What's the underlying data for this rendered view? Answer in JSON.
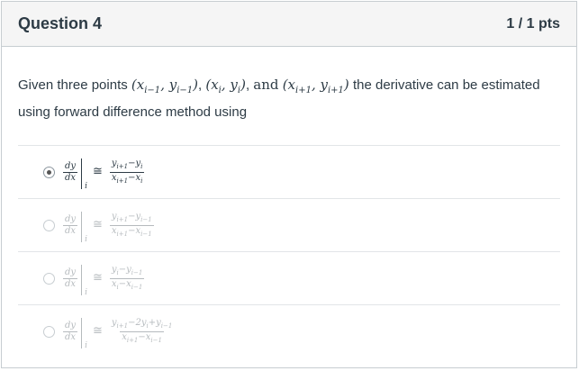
{
  "question": {
    "title": "Question 4",
    "points": "1 / 1 pts",
    "text_pre": "Given three points",
    "p1": "(x",
    "p1_sub": "i−1",
    "p1_mid": ", y",
    "p1_sub2": "i−1",
    "p1_end": ")",
    "p2": "(x",
    "p2_sub": "i",
    "p2_mid": ", y",
    "p2_sub2": "i",
    "p2_end": ")",
    "and": "and",
    "p3": "(x",
    "p3_sub": "i+1",
    "p3_mid": ", y",
    "p3_sub2": "i+1",
    "p3_end": ")",
    "text_post": "the derivative can be estimated using forward difference method using"
  },
  "answers": [
    {
      "lhs_num": "dy",
      "lhs_den": "dx",
      "eval": "i",
      "approx": "≅",
      "num": "y_{i+1}−y_i",
      "den": "x_{i+1}−x_i",
      "selected": true
    },
    {
      "lhs_num": "dy",
      "lhs_den": "dx",
      "eval": "i",
      "approx": "≅",
      "num": "y_{i+1}−y_{i−1}",
      "den": "x_{i+1}−x_{i−1}",
      "selected": false
    },
    {
      "lhs_num": "dy",
      "lhs_den": "dx",
      "eval": "i",
      "approx": "≅",
      "num": "y_i−y_{i−1}",
      "den": "x_i−x_{i−1}",
      "selected": false
    },
    {
      "lhs_num": "dy",
      "lhs_den": "dx",
      "eval": "i",
      "approx": "≅",
      "num": "y_{i+1}−2y_i+y_{i−1}",
      "den": "x_{i+1}−x_{i−1}",
      "selected": false
    }
  ]
}
